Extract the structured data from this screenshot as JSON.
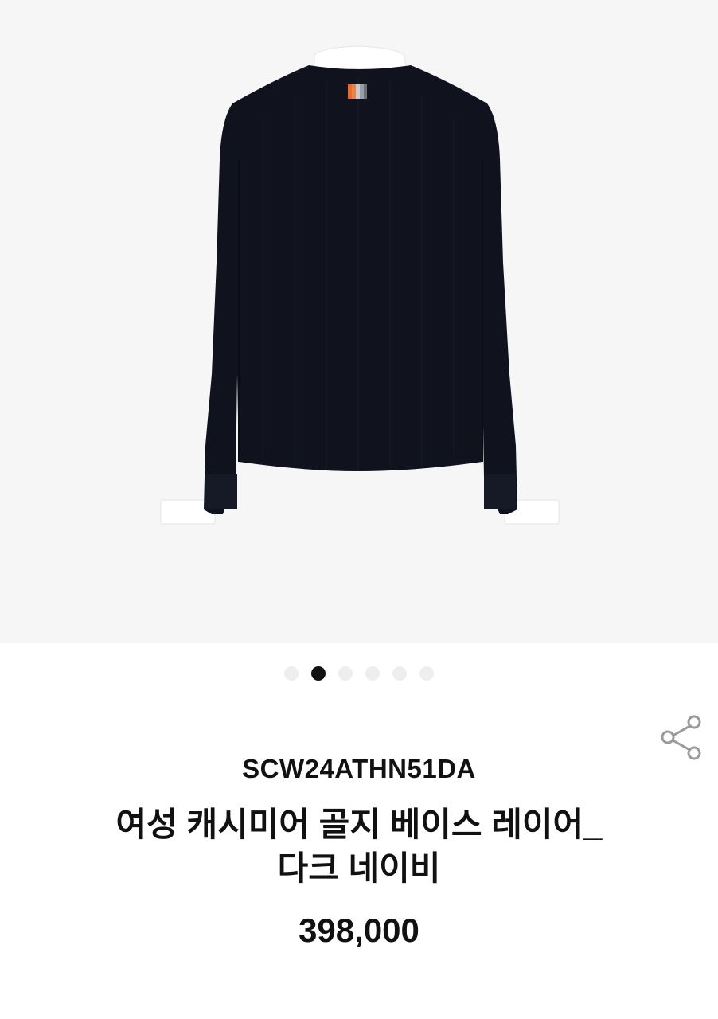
{
  "gallery": {
    "image_alt": "여성 캐시미어 골지 베이스 레이어_다크 네이비",
    "slide_count": 6,
    "active_index": 1,
    "colors": {
      "background": "#f6f6f6",
      "garment": "#10131d",
      "collar_cuff": "#ffffff",
      "label_orange": "#ef6a2a",
      "label_grey": "#9a9ea6",
      "dot_active": "#111111",
      "dot_inactive": "#eeeeee"
    }
  },
  "actions": {
    "share_icon": "share-icon"
  },
  "product": {
    "code": "SCW24ATHN51DA",
    "name_line1": "여성 캐시미어 골지 베이스 레이어_",
    "name_line2": "다크 네이비",
    "price": "398,000"
  }
}
